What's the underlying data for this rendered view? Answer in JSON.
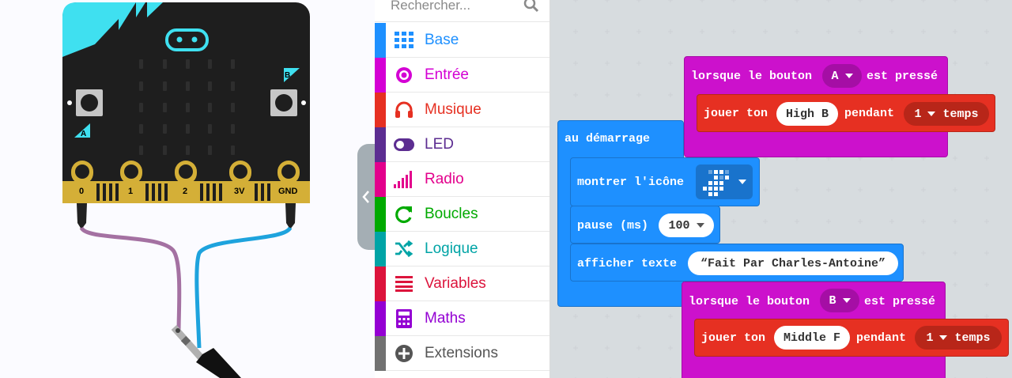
{
  "simulator": {
    "button_a": "A",
    "button_b": "B",
    "pins": [
      "0",
      "1",
      "2",
      "3V",
      "GND"
    ]
  },
  "toolbox": {
    "search_placeholder": "Rechercher...",
    "categories": [
      {
        "label": "Base",
        "icon": "grid-icon",
        "color": "#1e90ff"
      },
      {
        "label": "Entrée",
        "icon": "target-icon",
        "color": "#d400d4"
      },
      {
        "label": "Musique",
        "icon": "headphones-icon",
        "color": "#e63022"
      },
      {
        "label": "LED",
        "icon": "toggle-icon",
        "color": "#5c2d91"
      },
      {
        "label": "Radio",
        "icon": "signal-bars-icon",
        "color": "#e3008c"
      },
      {
        "label": "Boucles",
        "icon": "refresh-icon",
        "color": "#00aa00"
      },
      {
        "label": "Logique",
        "icon": "shuffle-icon",
        "color": "#00a4a6"
      },
      {
        "label": "Variables",
        "icon": "list-icon",
        "color": "#dc143c"
      },
      {
        "label": "Maths",
        "icon": "calculator-icon",
        "color": "#9400d3"
      },
      {
        "label": "Extensions",
        "icon": "plus-circle-icon",
        "color": "#717171"
      }
    ]
  },
  "colors": {
    "base_blue": "#1e90ff",
    "input_pink": "#cc11cc",
    "music_red": "#e63022",
    "board_black": "#1e1e1e",
    "board_cyan": "#3fe0f0",
    "pin_gold": "#d4af37"
  },
  "workspace": {
    "on_button_a": {
      "label": "lorsque le bouton",
      "button": "A",
      "suffix": "est pressé"
    },
    "play_tone_a": {
      "label": "jouer ton",
      "note": "High B",
      "for": "pendant",
      "beats": "1",
      "unit": "temps"
    },
    "on_start": {
      "label": "au démarrage"
    },
    "show_icon": {
      "label": "montrer l'icône"
    },
    "pause": {
      "label": "pause (ms)",
      "value": "100"
    },
    "show_string": {
      "label": "afficher texte",
      "value": "Fait Par Charles-Antoine"
    },
    "on_button_b": {
      "label": "lorsque le bouton",
      "button": "B",
      "suffix": "est pressé"
    },
    "play_tone_b": {
      "label": "jouer ton",
      "note": "Middle F",
      "for": "pendant",
      "beats": "1",
      "unit": "temps"
    }
  }
}
